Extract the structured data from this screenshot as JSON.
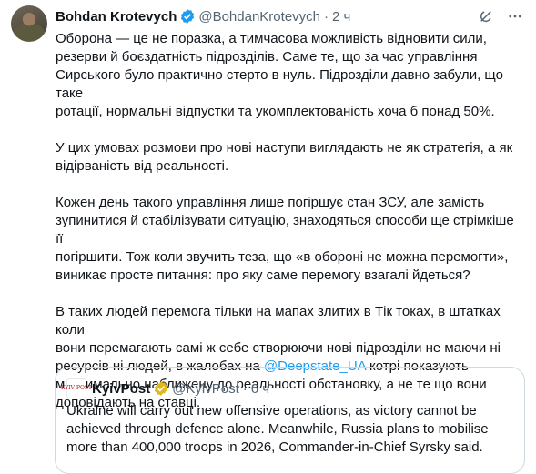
{
  "tweet": {
    "author_name": "Bohdan Krotevych",
    "handle": "@BohdanKrotevych",
    "time": "2 ч",
    "paragraphs": [
      "Оборона — це не поразка, а тимчасова можливість відновити сили,\nрезерви й боєздатність підрозділів. Саме те, що за час управління\nСирського було практично стерто в нуль. Підрозділи давно забули, що таке\nротації, нормальні відпустки та укомплектованість хоча б понад 50%.",
      "У цих умовах розмови про нові наступи виглядають не як стратегія, а як\nвідірваність від реальності.",
      "Кожен день такого управління лише погіршує стан ЗСУ, але замість\nзупинитися й стабілізувати ситуацію, знаходяться способи ще стрімкіше її\nпогіршити. Тож коли звучить теза, що «в обороні не можна перемогти»,\nвиникає просте питання: про яку саме перемогу взагалі йдеться?"
    ],
    "last_paragraph": {
      "before_mention": "В таких людей перемога тільки на мапах злитих в Тік токах, в штатках коли\nвони перемагають самі ж себе створюючи нові підрозділи не маючи ні\nресурсів ні людей, в жалобах на ",
      "mention": "@Deepstate_UA",
      "after_mention": " котрі показують\nмаксимально наближену до реальності обстановку, а не те що вони\nдоповідають на ставці."
    }
  },
  "quoted": {
    "logo_text": "KYIV POST",
    "author_name": "KyivPost",
    "handle": "@KyivPost",
    "time": "6 ч",
    "text": "Ukraine will carry out new offensive operations, as victory cannot be\nachieved through defence alone. Meanwhile, Russia plans to mobilise\nmore than 400,000 troops in 2026, Commander-in-Chief Syrsky said."
  },
  "colors": {
    "accent": "#1d9bf0",
    "muted": "#536471",
    "border": "#cfd9de",
    "gold": "#e2b719"
  },
  "icons": [
    "verified-badge-icon",
    "grok-icon",
    "more-icon",
    "kyivpost-logo-icon",
    "gold-verified-badge-icon"
  ]
}
